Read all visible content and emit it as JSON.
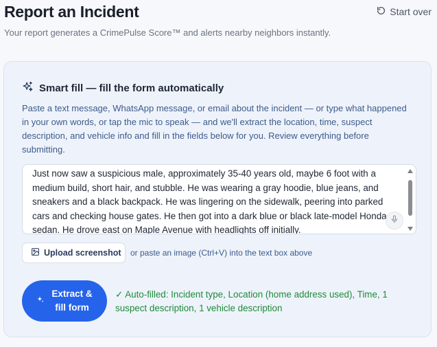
{
  "header": {
    "title": "Report an Incident",
    "start_over_label": "Start over",
    "subtitle": "Your report generates a CrimePulse Score™ and alerts nearby neighbors instantly."
  },
  "smart_fill": {
    "heading": "Smart fill — fill the form automatically",
    "description": "Paste a text message, WhatsApp message, or email about the incident — or type what happened in your own words, or tap the mic to speak — and we'll extract the location, time, suspect description, and vehicle info and fill in the fields below for you. Review everything before submitting.",
    "textarea_value": "Just now saw a suspicious male, approximately 35-40 years old, maybe 6 foot with a medium build, short hair, and stubble. He was wearing a gray hoodie, blue jeans, and sneakers and a black backpack. He was lingering on the sidewalk, peering into parked cars and checking house gates. He then got into a dark blue or black late-model Honda sedan. He drove east on Maple Avenue with headlights off initially.",
    "upload_label": "Upload screenshot",
    "paste_hint": "or paste an image (Ctrl+V) into the text box above",
    "extract_label_line1": "Extract &",
    "extract_label_line2": "fill form",
    "autofill_message": "✓ Auto-filled: Incident type, Location (home address used), Time, 1 suspect description, 1 vehicle description"
  },
  "colors": {
    "accent": "#2563eb",
    "success": "#1f8a3a",
    "card_bg": "#eef3fb",
    "description_text": "#3d5a8a"
  },
  "icons": {
    "start_over": "rotate-ccw-icon",
    "smart_fill": "sparkles-icon",
    "mic": "microphone-icon",
    "upload": "image-icon",
    "extract": "sparkles-icon"
  }
}
